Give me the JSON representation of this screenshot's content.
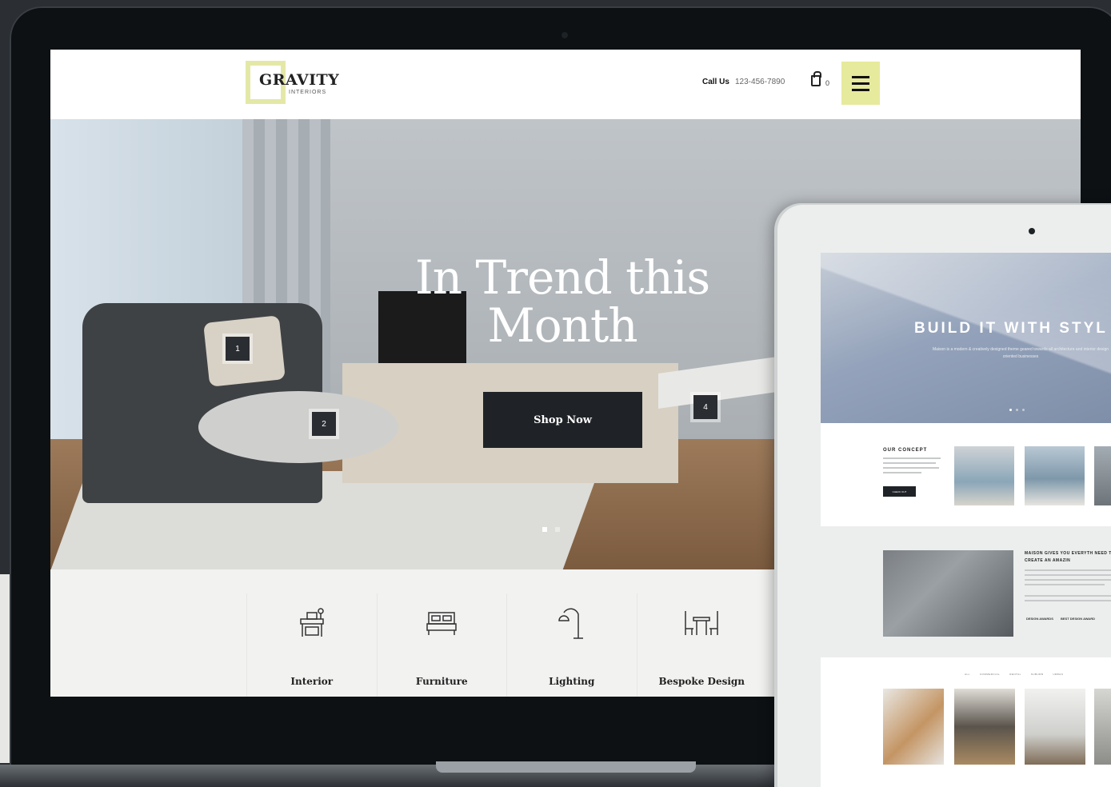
{
  "site": {
    "logo_name": "GRAVITY",
    "logo_sub": "INTERIORS",
    "call_label": "Call Us",
    "phone": "123-456-7890",
    "cart_count": "0"
  },
  "hero": {
    "title": "In Trend this Month",
    "button": "Shop Now",
    "hotspots": [
      "1",
      "2",
      "4"
    ],
    "slides_total": 2,
    "active_slide": 1
  },
  "categories": [
    {
      "label": "Interior",
      "icon": "interior-icon"
    },
    {
      "label": "Furniture",
      "icon": "bed-icon"
    },
    {
      "label": "Lighting",
      "icon": "lamp-icon"
    },
    {
      "label": "Bespoke Design",
      "icon": "chairs-table-icon"
    }
  ],
  "tablet": {
    "hero_title": "BUILD IT WITH STYL",
    "hero_text": "Maison is a modern & creatively designed theme geared towards all architecture and interior design oriented businesses",
    "concept_title": "OUR CONCEPT",
    "concept_button": "CHECK OUT",
    "maison_title": "MAISON GIVES YOU EVERYTH NEED TO CREATE AN AMAZIN",
    "awards": [
      "DESIGN AWARDS",
      "BEST DESIGN AWARD"
    ],
    "filters": [
      "ALL",
      "COMMERCIAL",
      "RENTAL",
      "SUBURB",
      "URBAN"
    ]
  },
  "colors": {
    "accent": "#e6ea9c",
    "dark": "#1f2327"
  }
}
